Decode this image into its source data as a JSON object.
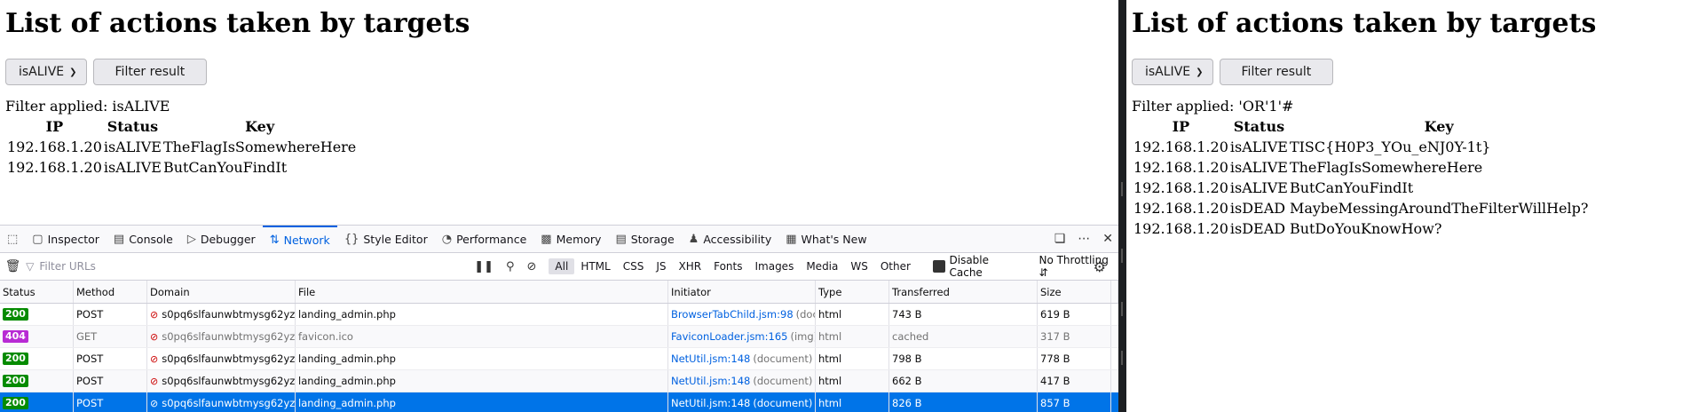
{
  "left": {
    "title": "List of actions taken by targets",
    "select_value": "isALIVE",
    "filter_button": "Filter result",
    "filter_prefix": "Filter applied: ",
    "filter_value": "isALIVE",
    "headers": [
      "IP",
      "Status",
      "Key"
    ],
    "rows": [
      {
        "ip": "192.168.1.20",
        "status": "isALIVE",
        "key": "TheFlagIsSomewhereHere"
      },
      {
        "ip": "192.168.1.20",
        "status": "isALIVE",
        "key": "ButCanYouFindIt"
      }
    ]
  },
  "right": {
    "title": "List of actions taken by targets",
    "select_value": "isALIVE",
    "filter_button": "Filter result",
    "filter_prefix": "Filter applied: ",
    "filter_value": "'OR'1'#",
    "headers": [
      "IP",
      "Status",
      "Key"
    ],
    "rows": [
      {
        "ip": "192.168.1.20",
        "status": "isALIVE",
        "key": "TISC{H0P3_YOu_eNJ0Y-1t}"
      },
      {
        "ip": "192.168.1.20",
        "status": "isALIVE",
        "key": "TheFlagIsSomewhereHere"
      },
      {
        "ip": "192.168.1.20",
        "status": "isALIVE",
        "key": "ButCanYouFindIt"
      },
      {
        "ip": "192.168.1.20",
        "status": "isDEAD",
        "key": "MaybeMessingAroundTheFilterWillHelp?"
      },
      {
        "ip": "192.168.1.20",
        "status": "isDEAD",
        "key": "ButDoYouKnowHow?"
      }
    ]
  },
  "devtools": {
    "tabs": [
      {
        "label": "Inspector",
        "icon": "inspector-icon"
      },
      {
        "label": "Console",
        "icon": "console-icon"
      },
      {
        "label": "Debugger",
        "icon": "debugger-icon"
      },
      {
        "label": "Network",
        "icon": "network-icon"
      },
      {
        "label": "Style Editor",
        "icon": "style-editor-icon"
      },
      {
        "label": "Performance",
        "icon": "performance-icon"
      },
      {
        "label": "Memory",
        "icon": "memory-icon"
      },
      {
        "label": "Storage",
        "icon": "storage-icon"
      },
      {
        "label": "Accessibility",
        "icon": "accessibility-icon"
      },
      {
        "label": "What's New",
        "icon": "gift-icon"
      }
    ],
    "active_tab": "Network",
    "filter_placeholder": "Filter URLs",
    "types": [
      "All",
      "HTML",
      "CSS",
      "JS",
      "XHR",
      "Fonts",
      "Images",
      "Media",
      "WS",
      "Other"
    ],
    "active_type": "All",
    "disable_cache": "Disable Cache",
    "throttling": "No Throttling",
    "columns": [
      "Status",
      "Method",
      "Domain",
      "File",
      "Initiator",
      "Type",
      "Transferred",
      "Size"
    ],
    "requests": [
      {
        "status": "200",
        "method": "POST",
        "domain": "s0pq6slfaunwbtmysg62yz...",
        "file": "landing_admin.php",
        "initiator": "BrowserTabChild.jsm:98",
        "initiator_note": "(doc...",
        "type": "html",
        "transferred": "743 B",
        "size": "619 B"
      },
      {
        "status": "404",
        "method": "GET",
        "domain": "s0pq6slfaunwbtmysg62yz...",
        "file": "favicon.ico",
        "initiator": "FaviconLoader.jsm:165",
        "initiator_note": "(img)",
        "type": "html",
        "transferred": "cached",
        "size": "317 B"
      },
      {
        "status": "200",
        "method": "POST",
        "domain": "s0pq6slfaunwbtmysg62yz...",
        "file": "landing_admin.php",
        "initiator": "NetUtil.jsm:148",
        "initiator_note": "(document)",
        "type": "html",
        "transferred": "798 B",
        "size": "778 B"
      },
      {
        "status": "200",
        "method": "POST",
        "domain": "s0pq6slfaunwbtmysg62yz...",
        "file": "landing_admin.php",
        "initiator": "NetUtil.jsm:148",
        "initiator_note": "(document)",
        "type": "html",
        "transferred": "662 B",
        "size": "417 B"
      },
      {
        "status": "200",
        "method": "POST",
        "domain": "s0pq6slfaunwbtmysg62yz...",
        "file": "landing_admin.php",
        "initiator": "NetUtil.jsm:148",
        "initiator_note": "(document)",
        "type": "html",
        "transferred": "826 B",
        "size": "857 B"
      }
    ],
    "selected_request": 4
  }
}
